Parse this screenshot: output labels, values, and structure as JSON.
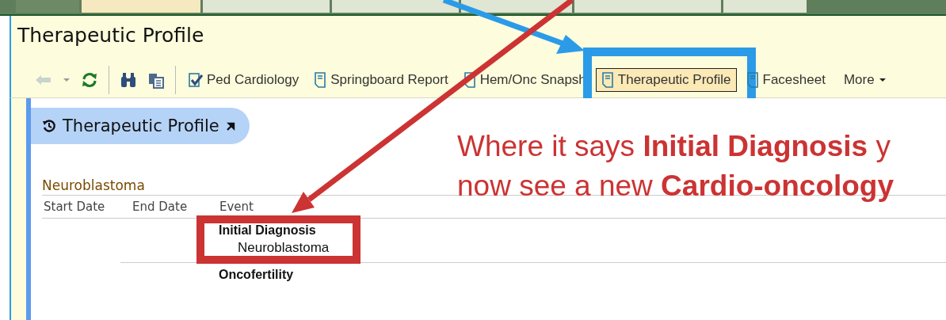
{
  "page": {
    "title": "Therapeutic Profile"
  },
  "toolbar": {
    "back_disabled": true,
    "links": [
      {
        "label": "Ped Cardiology",
        "kind": "check",
        "selected": false
      },
      {
        "label": "Springboard Report",
        "kind": "doc",
        "selected": false
      },
      {
        "label": "Hem/Onc Snapsh",
        "kind": "doc",
        "selected": false
      },
      {
        "label": "Therapeutic Profile",
        "kind": "doc",
        "selected": true
      },
      {
        "label": "Facesheet",
        "kind": "doc",
        "selected": false
      }
    ],
    "more": "More"
  },
  "panel": {
    "title": "Therapeutic Profile",
    "section": "Neuroblastoma",
    "columns": [
      "Start Date",
      "End Date",
      "Event"
    ],
    "rows": [
      {
        "event": "Initial Diagnosis",
        "highlighted": true,
        "children": [
          {
            "event": "Neuroblastoma"
          }
        ]
      },
      {
        "event": "Oncofertility",
        "highlighted": false,
        "children": []
      }
    ]
  },
  "annotation": {
    "lines": [
      "Where it says **Initial Diagnosis** y",
      "now see a new **Cardio-oncology**"
    ]
  }
}
